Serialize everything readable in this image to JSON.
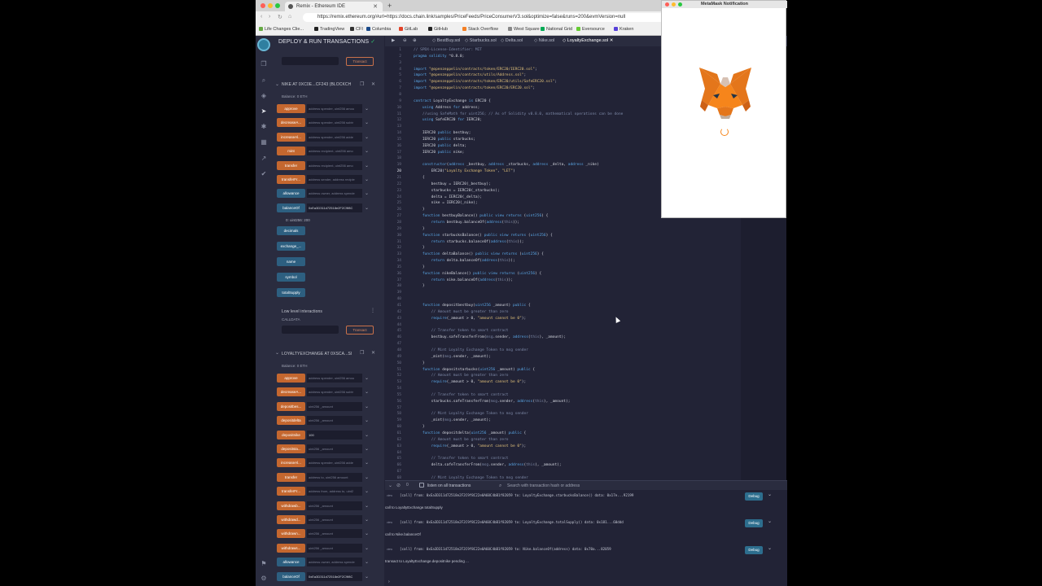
{
  "browser": {
    "tab_title": "Remix - Ethereum IDE",
    "url": "https://remix.ethereum.org/#url=https://docs.chain.link/samples/PriceFeeds/PriceConsumerV3.sol&optimize=false&runs=200&evmVersion=null",
    "bookmarks": [
      "Life Changes Clie...",
      "TradingView",
      "CFI",
      "Columbia",
      "GitLab",
      "GitHub",
      "Stack Overflow",
      "West Square",
      "National Grid",
      "Eversource",
      "Kraken"
    ],
    "bookmark_colors": [
      "#6a4",
      "#222",
      "#333",
      "#1a4a8a",
      "#e24329",
      "#222",
      "#f48024",
      "#888",
      "#0a5",
      "#6c3",
      "#5741d9"
    ]
  },
  "panel": {
    "title": "DEPLOY & RUN TRANSACTIONS",
    "transact_label": "Transact",
    "nike": {
      "title": "NIKE AT 0XC0E...CF243 (BLOCKCH",
      "balance": "Balance: 0 ETH",
      "functions": [
        {
          "label": "approve",
          "color": "orange",
          "hint": "address spender, uint256 amou"
        },
        {
          "label": "decreaseA...",
          "color": "orange",
          "hint": "address spender, uint256 subtr"
        },
        {
          "label": "increaseAl...",
          "color": "orange",
          "hint": "address spender, uint256 adde"
        },
        {
          "label": "mint",
          "color": "orange",
          "hint": "address recipient, uint256 amo"
        },
        {
          "label": "transfer",
          "color": "orange",
          "hint": "address recipient, uint256 amo"
        },
        {
          "label": "transferFr...",
          "color": "orange",
          "hint": "address sender, address recipie"
        },
        {
          "label": "allowance",
          "color": "blue",
          "hint": "address owner, address spende"
        },
        {
          "label": "balanceOf",
          "color": "blue",
          "value": "0xEa3D311d72518e2F2C9f8C"
        }
      ],
      "result": "0: uint256: 200",
      "calls": [
        "decimals",
        "exchange_...",
        "name",
        "symbol",
        "totalSupply"
      ]
    },
    "low_level": {
      "title": "Low level interactions",
      "calldata": "CALLDATA"
    },
    "loyalty": {
      "title": "LOYALTYEXCHANGE AT 0XSCA...SI",
      "balance": "Balance: 0 ETH",
      "functions": [
        {
          "label": "approve",
          "color": "orange",
          "hint": "address spender, uint256 amou"
        },
        {
          "label": "decreaseA...",
          "color": "orange",
          "hint": "address spender, uint256 subtr"
        },
        {
          "label": "depositbes...",
          "color": "orange",
          "hint": "uint256 _amount"
        },
        {
          "label": "depositdelta",
          "color": "orange",
          "hint": "uint256 _amount"
        },
        {
          "label": "depositnike",
          "color": "orange",
          "value": "100"
        },
        {
          "label": "depositsta...",
          "color": "orange",
          "hint": "uint256 _amount"
        },
        {
          "label": "increaseAl...",
          "color": "orange",
          "hint": "address spender, uint256 adde"
        },
        {
          "label": "transfer",
          "color": "orange",
          "hint": "address to, uint256 amount"
        },
        {
          "label": "transferFr...",
          "color": "orange",
          "hint": "address from, address to, uint2"
        },
        {
          "label": "withdrawb...",
          "color": "orange",
          "hint": "uint256 _amount"
        },
        {
          "label": "withdrawd...",
          "color": "orange",
          "hint": "uint256 _amount"
        },
        {
          "label": "withdrawn...",
          "color": "orange",
          "hint": "uint256 _amount"
        },
        {
          "label": "withdraws...",
          "color": "orange",
          "hint": "uint256 _amount"
        },
        {
          "label": "allowance",
          "color": "blue",
          "hint": "address owner, address spende"
        },
        {
          "label": "balanceOf",
          "color": "blue",
          "value": "0xEa3D311d72518e2F2C9f8C"
        }
      ]
    }
  },
  "editor": {
    "tabs": [
      "BestBuy.sol",
      "Starbucks.sol",
      "Delta.sol",
      "Nike.sol",
      "LoyaltyExchange.sol"
    ],
    "active_tab": "LoyaltyExchange.sol",
    "highlight_line": 20,
    "lines": [
      [
        [
          "cm",
          "// SPDX-License-Identifier: MIT"
        ]
      ],
      [
        [
          "kw",
          "pragma solidity "
        ],
        [
          "fn",
          "^0.8.0;"
        ]
      ],
      [],
      [
        [
          "kw",
          "import "
        ],
        [
          "st",
          "\"@openzeppelin/contracts/token/ERC20/IERC20.sol\""
        ],
        [
          "fn",
          ";"
        ]
      ],
      [
        [
          "kw",
          "import "
        ],
        [
          "st",
          "\"@openzeppelin/contracts/utils/Address.sol\""
        ],
        [
          "fn",
          ";"
        ]
      ],
      [
        [
          "kw",
          "import "
        ],
        [
          "st",
          "\"@openzeppelin/contracts/token/ERC20/utils/SafeERC20.sol\""
        ],
        [
          "fn",
          ";"
        ]
      ],
      [
        [
          "kw",
          "import "
        ],
        [
          "st",
          "\"@openzeppelin/contracts/token/ERC20/ERC20.sol\""
        ],
        [
          "fn",
          ";"
        ]
      ],
      [],
      [
        [
          "kw",
          "contract "
        ],
        [
          "fn",
          "LoyaltyExchange "
        ],
        [
          "kw",
          "is "
        ],
        [
          "fn",
          "ERC20 {"
        ]
      ],
      [
        [
          "fn",
          "    "
        ],
        [
          "kw",
          "using "
        ],
        [
          "fn",
          "Address "
        ],
        [
          "kw",
          "for "
        ],
        [
          "fn",
          "address;"
        ]
      ],
      [
        [
          "cm",
          "    //using SafeMath for uint256; // As of Solidity v0.8.0, mathematical operations can be done"
        ]
      ],
      [
        [
          "fn",
          "    "
        ],
        [
          "kw",
          "using "
        ],
        [
          "fn",
          "SafeERC20 "
        ],
        [
          "kw",
          "for "
        ],
        [
          "fn",
          "IERC20;"
        ]
      ],
      [],
      [
        [
          "fn",
          "    IERC20 "
        ],
        [
          "kw",
          "public "
        ],
        [
          "fn",
          "bestbuy;"
        ]
      ],
      [
        [
          "fn",
          "    IERC20 "
        ],
        [
          "kw",
          "public "
        ],
        [
          "fn",
          "starbucks;"
        ]
      ],
      [
        [
          "fn",
          "    IERC20 "
        ],
        [
          "kw",
          "public "
        ],
        [
          "fn",
          "delta;"
        ]
      ],
      [
        [
          "fn",
          "    IERC20 "
        ],
        [
          "kw",
          "public "
        ],
        [
          "fn",
          "nike;"
        ]
      ],
      [],
      [
        [
          "fn",
          "    "
        ],
        [
          "kw",
          "constructor"
        ],
        [
          "fn",
          "("
        ],
        [
          "kw",
          "address "
        ],
        [
          "fn",
          "_bestbuy, "
        ],
        [
          "kw",
          "address "
        ],
        [
          "fn",
          "_starbucks, "
        ],
        [
          "kw",
          "address "
        ],
        [
          "fn",
          "_delta, "
        ],
        [
          "kw",
          "address "
        ],
        [
          "fn",
          "_nike)"
        ]
      ],
      [
        [
          "fn",
          "        ERC20("
        ],
        [
          "st",
          "\"Loyalty Exchange Token\""
        ],
        [
          "fn",
          ", "
        ],
        [
          "st",
          "\"LET\""
        ],
        [
          "fn",
          ")"
        ]
      ],
      [
        [
          "fn",
          "    {"
        ]
      ],
      [
        [
          "fn",
          "        bestbuy = IERC20(_bestbuy);"
        ]
      ],
      [
        [
          "fn",
          "        starbucks = IERC20(_starbucks);"
        ]
      ],
      [
        [
          "fn",
          "        delta = IERC20(_delta);"
        ]
      ],
      [
        [
          "fn",
          "        nike = IERC20(_nike);"
        ]
      ],
      [
        [
          "fn",
          "    }"
        ]
      ],
      [
        [
          "fn",
          "    "
        ],
        [
          "kw",
          "function "
        ],
        [
          "fn",
          "bestbuyBalance() "
        ],
        [
          "kw",
          "public view returns "
        ],
        [
          "fn",
          "("
        ],
        [
          "kw",
          "uint256"
        ],
        [
          "fn",
          ") {"
        ]
      ],
      [
        [
          "fn",
          "        "
        ],
        [
          "kw",
          "return "
        ],
        [
          "fn",
          "bestbuy.balanceOf("
        ],
        [
          "kw",
          "address"
        ],
        [
          "fn",
          "("
        ],
        [
          "cm",
          "this"
        ],
        [
          "fn",
          "));"
        ]
      ],
      [
        [
          "fn",
          "    }"
        ]
      ],
      [
        [
          "fn",
          "    "
        ],
        [
          "kw",
          "function "
        ],
        [
          "fn",
          "starbucksBalance() "
        ],
        [
          "kw",
          "public view returns "
        ],
        [
          "fn",
          "("
        ],
        [
          "kw",
          "uint256"
        ],
        [
          "fn",
          ") {"
        ]
      ],
      [
        [
          "fn",
          "        "
        ],
        [
          "kw",
          "return "
        ],
        [
          "fn",
          "starbucks.balanceOf("
        ],
        [
          "kw",
          "address"
        ],
        [
          "fn",
          "("
        ],
        [
          "cm",
          "this"
        ],
        [
          "fn",
          "));"
        ]
      ],
      [
        [
          "fn",
          "    }"
        ]
      ],
      [
        [
          "fn",
          "    "
        ],
        [
          "kw",
          "function "
        ],
        [
          "fn",
          "deltaBalance() "
        ],
        [
          "kw",
          "public view returns "
        ],
        [
          "fn",
          "("
        ],
        [
          "kw",
          "uint256"
        ],
        [
          "fn",
          ") {"
        ]
      ],
      [
        [
          "fn",
          "        "
        ],
        [
          "kw",
          "return "
        ],
        [
          "fn",
          "delta.balanceOf("
        ],
        [
          "kw",
          "address"
        ],
        [
          "fn",
          "("
        ],
        [
          "cm",
          "this"
        ],
        [
          "fn",
          "));"
        ]
      ],
      [
        [
          "fn",
          "    }"
        ]
      ],
      [
        [
          "fn",
          "    "
        ],
        [
          "kw",
          "function "
        ],
        [
          "fn",
          "nikeBalance() "
        ],
        [
          "kw",
          "public view returns "
        ],
        [
          "fn",
          "("
        ],
        [
          "kw",
          "uint256"
        ],
        [
          "fn",
          ") {"
        ]
      ],
      [
        [
          "fn",
          "        "
        ],
        [
          "kw",
          "return "
        ],
        [
          "fn",
          "nike.balanceOf("
        ],
        [
          "kw",
          "address"
        ],
        [
          "fn",
          "("
        ],
        [
          "cm",
          "this"
        ],
        [
          "fn",
          "));"
        ]
      ],
      [
        [
          "fn",
          "    }"
        ]
      ],
      [],
      [],
      [
        [
          "fn",
          "    "
        ],
        [
          "kw",
          "function "
        ],
        [
          "fn",
          "depositbestbuy("
        ],
        [
          "kw",
          "uint256 "
        ],
        [
          "fn",
          "_amount) "
        ],
        [
          "kw",
          "public "
        ],
        [
          "fn",
          "{"
        ]
      ],
      [
        [
          "cm",
          "        // Amount must be greater than zero"
        ]
      ],
      [
        [
          "fn",
          "        "
        ],
        [
          "kw",
          "require"
        ],
        [
          "fn",
          "(_amount > 0, "
        ],
        [
          "st",
          "\"amount cannot be 0\""
        ],
        [
          "fn",
          ");"
        ]
      ],
      [],
      [
        [
          "cm",
          "        // Transfer token to smart contract"
        ]
      ],
      [
        [
          "fn",
          "        bestbuy.safeTransferFrom("
        ],
        [
          "cm",
          "msg"
        ],
        [
          "fn",
          ".sender, "
        ],
        [
          "kw",
          "address"
        ],
        [
          "fn",
          "("
        ],
        [
          "cm",
          "this"
        ],
        [
          "fn",
          "), _amount);"
        ]
      ],
      [],
      [
        [
          "cm",
          "        // Mint Loyalty Exchange Token to msg sender"
        ]
      ],
      [
        [
          "fn",
          "        _mint("
        ],
        [
          "cm",
          "msg"
        ],
        [
          "fn",
          ".sender, _amount);"
        ]
      ],
      [
        [
          "fn",
          "    }"
        ]
      ],
      [
        [
          "fn",
          "    "
        ],
        [
          "kw",
          "function "
        ],
        [
          "fn",
          "depositstarbucks("
        ],
        [
          "kw",
          "uint256 "
        ],
        [
          "fn",
          "_amount) "
        ],
        [
          "kw",
          "public "
        ],
        [
          "fn",
          "{"
        ]
      ],
      [
        [
          "cm",
          "        // Amount must be greater than zero"
        ]
      ],
      [
        [
          "fn",
          "        "
        ],
        [
          "kw",
          "require"
        ],
        [
          "fn",
          "(_amount > 0, "
        ],
        [
          "st",
          "\"amount cannot be 0\""
        ],
        [
          "fn",
          ");"
        ]
      ],
      [],
      [
        [
          "cm",
          "        // Transfer token to smart contract"
        ]
      ],
      [
        [
          "fn",
          "        starbucks.safeTransferFrom("
        ],
        [
          "cm",
          "msg"
        ],
        [
          "fn",
          ".sender, "
        ],
        [
          "kw",
          "address"
        ],
        [
          "fn",
          "("
        ],
        [
          "cm",
          "this"
        ],
        [
          "fn",
          "), _amount);"
        ]
      ],
      [],
      [
        [
          "cm",
          "        // Mint Loyalty Exchange Token to msg sender"
        ]
      ],
      [
        [
          "fn",
          "        _mint("
        ],
        [
          "cm",
          "msg"
        ],
        [
          "fn",
          ".sender, _amount);"
        ]
      ],
      [
        [
          "fn",
          "    }"
        ]
      ],
      [
        [
          "fn",
          "    "
        ],
        [
          "kw",
          "function "
        ],
        [
          "fn",
          "depositdelta("
        ],
        [
          "kw",
          "uint256 "
        ],
        [
          "fn",
          "_amount) "
        ],
        [
          "kw",
          "public "
        ],
        [
          "fn",
          "{"
        ]
      ],
      [
        [
          "cm",
          "        // Amount must be greater than zero"
        ]
      ],
      [
        [
          "fn",
          "        "
        ],
        [
          "kw",
          "require"
        ],
        [
          "fn",
          "(_amount > 0, "
        ],
        [
          "st",
          "\"amount cannot be 0\""
        ],
        [
          "fn",
          ");"
        ]
      ],
      [],
      [
        [
          "cm",
          "        // Transfer token to smart contract"
        ]
      ],
      [
        [
          "fn",
          "        delta.safeTransferFrom("
        ],
        [
          "cm",
          "msg"
        ],
        [
          "fn",
          ".sender, "
        ],
        [
          "kw",
          "address"
        ],
        [
          "fn",
          "("
        ],
        [
          "cm",
          "this"
        ],
        [
          "fn",
          "), _amount);"
        ]
      ],
      [],
      [
        [
          "cm",
          "        // Mint Loyalty Exchange Token to msg sender"
        ]
      ]
    ]
  },
  "terminal": {
    "listen_label": "listen on all transactions",
    "search_placeholder": "Search with transaction hash or address",
    "count": "0",
    "debug_label": "Debug",
    "badge": "view",
    "entries": [
      {
        "main": "[call]  from: 0xEa3D311d72518e2F2C9f8C22e0A60C4bB1f82059 to: LoyaltyExchange.starbucksBalance() data: 0x17e...92199",
        "sub": "call to LoyaltyExchange.totalSupply",
        "debug": true
      },
      {
        "main": "[call]  from: 0xEa3D311d72518e2F2C9f8C22e0A60C4bB1f82059 to: LoyaltyExchange.totalSupply() data: 0x181...60ddd",
        "sub": "call to Nike.balanceOf",
        "debug": true
      },
      {
        "main": "[call]  from: 0xEa3D311d72518e2F2C9f8C22e0A60C4bB1f82059 to: Nike.balanceOf(address) data: 0x70a...82059",
        "sub": "transact to LoyaltyExchange.depositnike pending ...",
        "debug": true
      }
    ]
  },
  "metamask": {
    "title": "MetaMask Notification"
  }
}
